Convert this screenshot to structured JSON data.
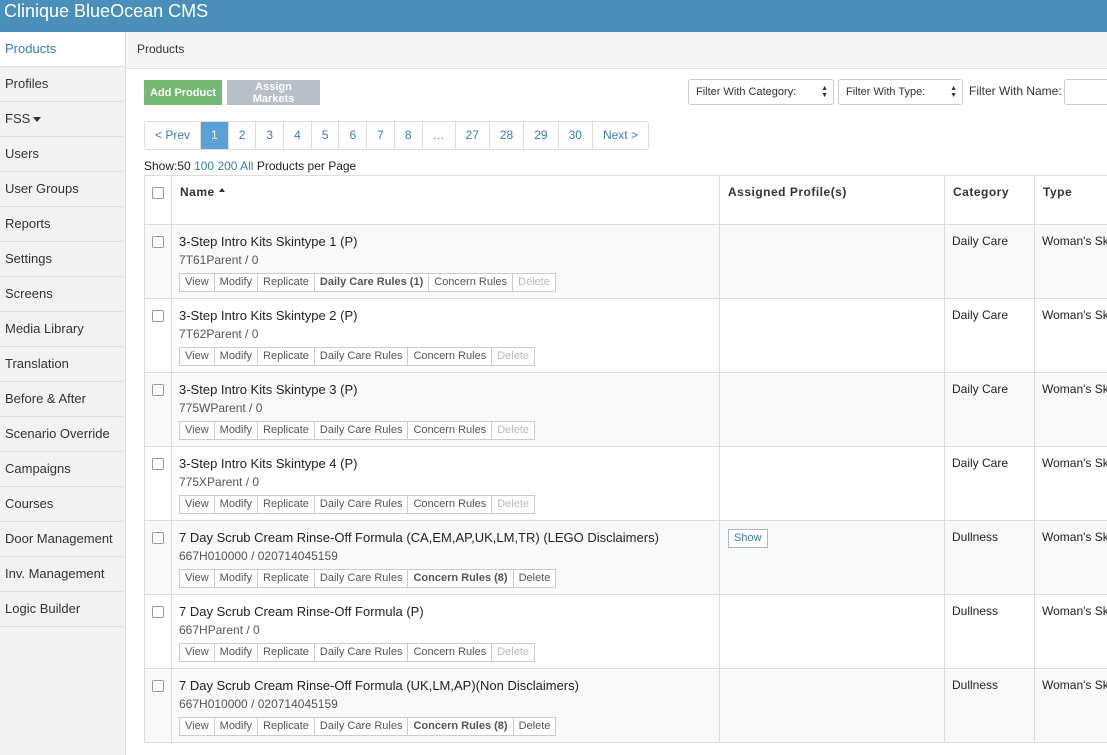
{
  "app": {
    "title": "Clinique BlueOcean CMS"
  },
  "sidebar": {
    "items": [
      {
        "label": "Products",
        "active": true
      },
      {
        "label": "Profiles"
      },
      {
        "label": "FSS",
        "dropdown": true
      },
      {
        "label": "Users"
      },
      {
        "label": "User Groups"
      },
      {
        "label": "Reports"
      },
      {
        "label": "Settings"
      },
      {
        "label": "Screens"
      },
      {
        "label": "Media Library"
      },
      {
        "label": "Translation"
      },
      {
        "label": "Before & After"
      },
      {
        "label": "Scenario Override"
      },
      {
        "label": "Campaigns"
      },
      {
        "label": "Courses"
      },
      {
        "label": "Door Management"
      },
      {
        "label": "Inv. Management"
      },
      {
        "label": "Logic Builder"
      }
    ]
  },
  "breadcrumb": "Products",
  "toolbar": {
    "add_label": "Add Product",
    "assign_label": "Assign Markets",
    "filter_category": "Filter With Category:",
    "filter_type": "Filter With Type:",
    "filter_name_label": "Filter With Name:",
    "filter_name_value": ""
  },
  "pagination": {
    "prev": "< Prev",
    "pages": [
      "1",
      "2",
      "3",
      "4",
      "5",
      "6",
      "7",
      "8",
      "…",
      "27",
      "28",
      "29",
      "30"
    ],
    "current": "1",
    "next": "Next >"
  },
  "per_page": {
    "show_label": "Show:",
    "current": "50",
    "options": [
      "100",
      "200",
      "All"
    ],
    "suffix": "Products per Page"
  },
  "table": {
    "headers": {
      "name": "Name",
      "profiles": "Assigned Profile(s)",
      "category": "Category",
      "type": "Type"
    },
    "rows": [
      {
        "name": "3-Step Intro Kits Skintype 1 (P)",
        "code": "7T61Parent / 0",
        "category": "Daily Care",
        "type": "Woman's Skin",
        "show": "",
        "actions": [
          {
            "label": "View"
          },
          {
            "label": "Modify"
          },
          {
            "label": "Replicate"
          },
          {
            "label": "Daily Care Rules (1)",
            "bold": true
          },
          {
            "label": "Concern Rules"
          },
          {
            "label": "Delete",
            "disabled": true
          }
        ]
      },
      {
        "name": "3-Step Intro Kits Skintype 2 (P)",
        "code": "7T62Parent / 0",
        "category": "Daily Care",
        "type": "Woman's Skin",
        "show": "",
        "actions": [
          {
            "label": "View"
          },
          {
            "label": "Modify"
          },
          {
            "label": "Replicate"
          },
          {
            "label": "Daily Care Rules"
          },
          {
            "label": "Concern Rules"
          },
          {
            "label": "Delete",
            "disabled": true
          }
        ]
      },
      {
        "name": "3-Step Intro Kits Skintype 3 (P)",
        "code": "775WParent / 0",
        "category": "Daily Care",
        "type": "Woman's Skin",
        "show": "",
        "actions": [
          {
            "label": "View"
          },
          {
            "label": "Modify"
          },
          {
            "label": "Replicate"
          },
          {
            "label": "Daily Care Rules"
          },
          {
            "label": "Concern Rules"
          },
          {
            "label": "Delete",
            "disabled": true
          }
        ]
      },
      {
        "name": "3-Step Intro Kits Skintype 4 (P)",
        "code": "775XParent / 0",
        "category": "Daily Care",
        "type": "Woman's Skin",
        "show": "",
        "actions": [
          {
            "label": "View"
          },
          {
            "label": "Modify"
          },
          {
            "label": "Replicate"
          },
          {
            "label": "Daily Care Rules"
          },
          {
            "label": "Concern Rules"
          },
          {
            "label": "Delete",
            "disabled": true
          }
        ]
      },
      {
        "name": "7 Day Scrub Cream Rinse-Off Formula (CA,EM,AP,UK,LM,TR) (LEGO Disclaimers)",
        "code": "667H010000 / 020714045159",
        "category": "Dullness",
        "type": "Woman's Skin",
        "show": "Show",
        "actions": [
          {
            "label": "View"
          },
          {
            "label": "Modify"
          },
          {
            "label": "Replicate"
          },
          {
            "label": "Daily Care Rules"
          },
          {
            "label": "Concern Rules (8)",
            "bold": true
          },
          {
            "label": "Delete"
          }
        ]
      },
      {
        "name": "7 Day Scrub Cream Rinse-Off Formula (P)",
        "code": "667HParent / 0",
        "category": "Dullness",
        "type": "Woman's Skin",
        "show": "",
        "actions": [
          {
            "label": "View"
          },
          {
            "label": "Modify"
          },
          {
            "label": "Replicate"
          },
          {
            "label": "Daily Care Rules"
          },
          {
            "label": "Concern Rules"
          },
          {
            "label": "Delete",
            "disabled": true
          }
        ]
      },
      {
        "name": "7 Day Scrub Cream Rinse-Off Formula (UK,LM,AP)(Non Disclaimers)",
        "code": "667H010000 / 020714045159",
        "category": "Dullness",
        "type": "Woman's Skin",
        "show": "",
        "actions": [
          {
            "label": "View"
          },
          {
            "label": "Modify"
          },
          {
            "label": "Replicate"
          },
          {
            "label": "Daily Care Rules"
          },
          {
            "label": "Concern Rules (8)",
            "bold": true
          },
          {
            "label": "Delete"
          }
        ]
      }
    ]
  }
}
